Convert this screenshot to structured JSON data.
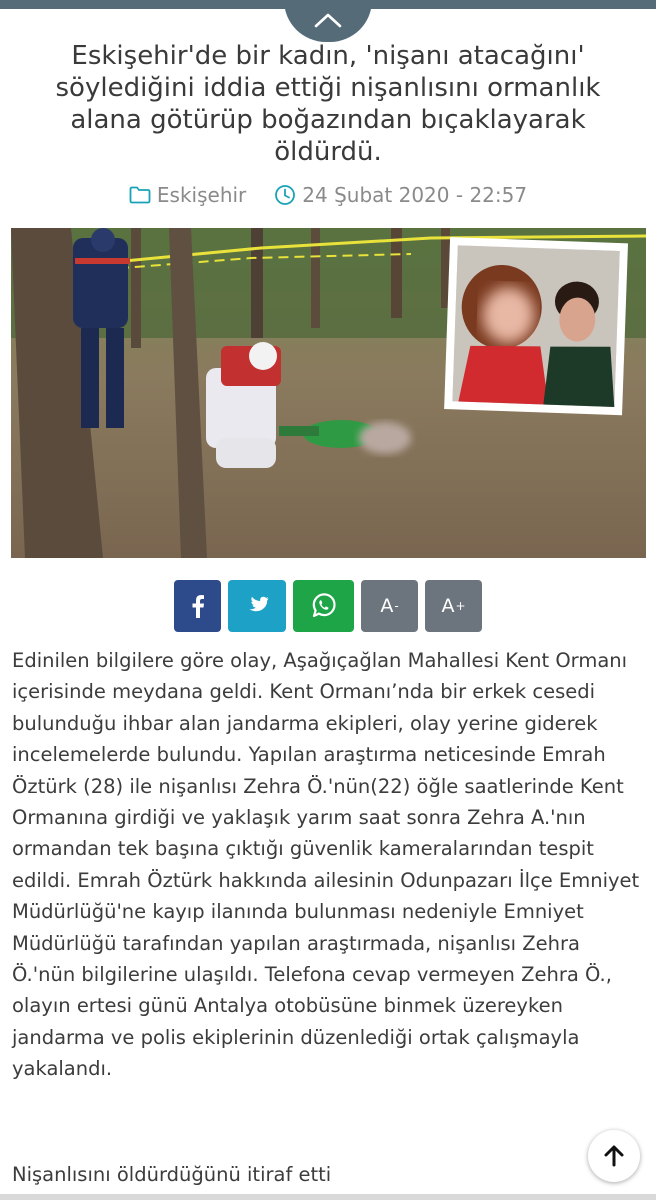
{
  "article": {
    "title": "Eskişehir'de bir kadın, 'nişanı atacağını' söylediğini iddia ettiği nişanlısını ormanlık alana götürüp boğazından bıçaklayarak öldürdü.",
    "category": "Eskişehir",
    "datetime": "24 Şubat 2020 - 22:57",
    "body": "Edinilen bilgilere göre olay, Aşağıçağlan Mahallesi Kent Ormanı içerisinde meydana geldi. Kent Ormanı’nda bir erkek cesedi bulunduğu ihbar alan jandarma ekipleri, olay yerine giderek incelemelerde bulundu. Yapılan araştırma neticesinde Emrah Öztürk (28) ile nişanlısı Zehra Ö.'nün(22) öğle saatlerinde Kent Ormanına girdiği ve yaklaşık yarım saat sonra Zehra A.'nın ormandan tek başına çıktığı güvenlik kameralarından tespit edildi. Emrah Öztürk hakkında ailesinin Odunpazarı İlçe Emniyet Müdürlüğü'ne kayıp ilanında bulunması nedeniyle Emniyet Müdürlüğü tarafından yapılan araştırmada, nişanlısı Zehra Ö.'nün bilgilerine ulaşıldı. Telefona cevap vermeyen Zehra Ö., olayın ertesi günü Antalya otobüsüne binmek üzereyken jandarma ve polis ekiplerinin düzenlediği ortak çalışmayla yakalandı.",
    "subheading": "Nişanlısını öldürdüğünü itiraf etti"
  },
  "share": {
    "font_smaller_label": "A",
    "font_smaller_mark": "-",
    "font_larger_label": "A",
    "font_larger_mark": "+"
  },
  "icons": {
    "collapse": "chevron-up-icon",
    "category": "folder-icon",
    "time": "clock-icon",
    "facebook": "facebook-icon",
    "twitter": "twitter-icon",
    "whatsapp": "whatsapp-icon",
    "scroll_top": "arrow-up-icon"
  },
  "colors": {
    "header": "#556b78",
    "accent": "#1aa3b8",
    "facebook": "#2d4a8a",
    "twitter": "#1da1c6",
    "whatsapp": "#1ea548",
    "font_buttons": "#6c757d"
  }
}
